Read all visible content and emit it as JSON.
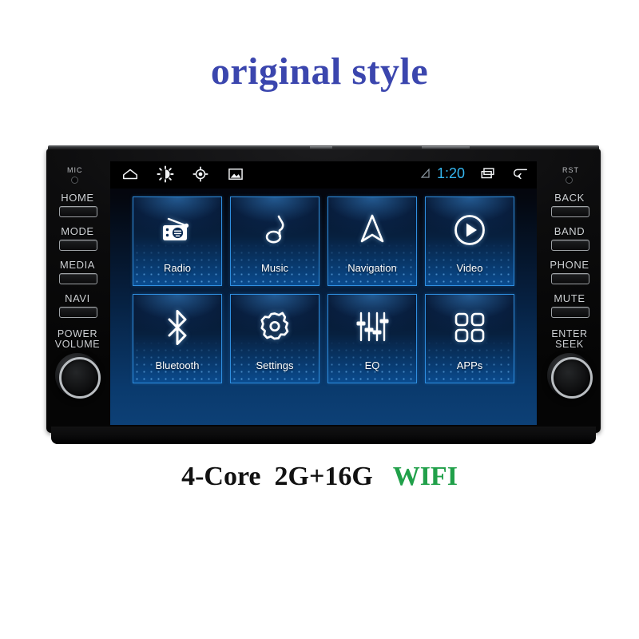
{
  "headline": "original style",
  "caption": {
    "specs": "4-Core  2G+16G   ",
    "wifi": "WIFI",
    "wifi_color": "#21a04a",
    "text_color": "#111111"
  },
  "colors": {
    "headline": "#3b46ae",
    "tile_border": "#2f8fe0",
    "clock": "#35b6ef",
    "bezel": "#0a0a0b"
  },
  "unit": {
    "left_panel": {
      "mic_label": "MIC",
      "buttons": [
        {
          "label": "HOME",
          "name": "home"
        },
        {
          "label": "MODE",
          "name": "mode"
        },
        {
          "label": "MEDIA",
          "name": "media"
        },
        {
          "label": "NAVI",
          "name": "navi"
        }
      ],
      "knob": {
        "line1": "POWER",
        "line2": "VOLUME",
        "name": "power-volume"
      }
    },
    "right_panel": {
      "rst_label": "RST",
      "buttons": [
        {
          "label": "BACK",
          "name": "back"
        },
        {
          "label": "BAND",
          "name": "band"
        },
        {
          "label": "PHONE",
          "name": "phone"
        },
        {
          "label": "MUTE",
          "name": "mute"
        }
      ],
      "knob": {
        "line1": "ENTER",
        "line2": "SEEK",
        "name": "enter-seek"
      }
    }
  },
  "screen": {
    "status_bar": {
      "left_icons": [
        "home-icon",
        "brightness-icon",
        "gps-icon",
        "gallery-icon"
      ],
      "signal_icon": "signal-triangle-icon",
      "clock": "1:20",
      "right_icons": [
        "recent-apps-icon",
        "back-arrow-icon"
      ]
    },
    "apps": [
      {
        "label": "Radio",
        "icon": "radio-icon"
      },
      {
        "label": "Music",
        "icon": "music-note-icon"
      },
      {
        "label": "Navigation",
        "icon": "navigation-arrow-icon"
      },
      {
        "label": "Video",
        "icon": "play-circle-icon"
      },
      {
        "label": "Bluetooth",
        "icon": "bluetooth-icon"
      },
      {
        "label": "Settings",
        "icon": "gear-icon"
      },
      {
        "label": "EQ",
        "icon": "equalizer-icon"
      },
      {
        "label": "APPs",
        "icon": "app-grid-icon"
      }
    ]
  }
}
